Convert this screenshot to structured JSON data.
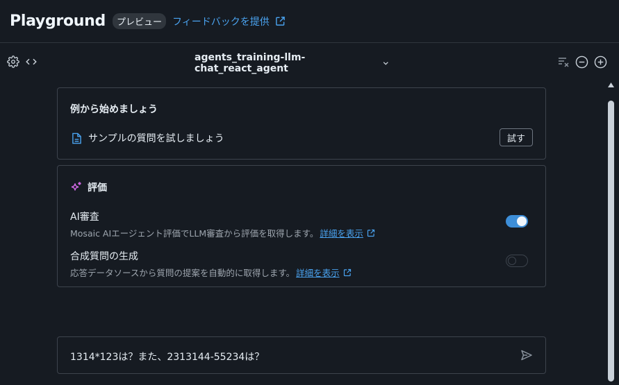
{
  "header": {
    "title": "Playground",
    "badge": "プレビュー",
    "feedback_link": "フィードバックを提供"
  },
  "toolbar": {
    "agent_name": "agents_training-llm-chat_react_agent"
  },
  "examples": {
    "title": "例から始めましょう",
    "sample_label": "サンプルの質問を試しましょう",
    "try_button": "試す"
  },
  "evaluation": {
    "title": "評価",
    "options": [
      {
        "title": "AI審査",
        "desc": "Mosaic AIエージェント評価でLLM審査から評価を取得します。",
        "link": "詳細を表示",
        "enabled": true
      },
      {
        "title": "合成質問の生成",
        "desc": "応答データソースから質問の提案を自動的に取得します。",
        "link": "詳細を表示",
        "enabled": false
      }
    ]
  },
  "chat": {
    "input_value": "1314*123は？また、2313144-55234は？"
  },
  "colors": {
    "accent": "#4aa3f0",
    "toggle_on": "#3d8ed8",
    "background": "#161b22",
    "sparkle": "#d46ae8"
  }
}
